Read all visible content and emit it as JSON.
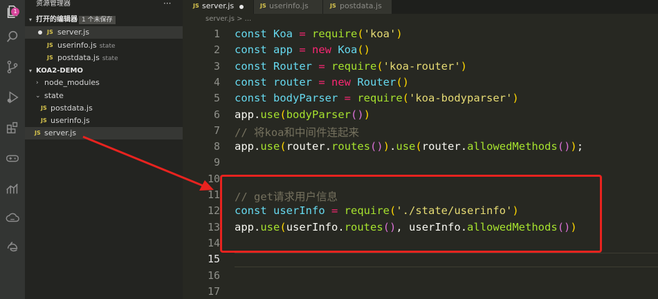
{
  "activity_bar": {
    "badge": "1",
    "icons": [
      "files-icon",
      "search-icon",
      "source-control-icon",
      "run-debug-icon",
      "extensions-icon",
      "gamepad-icon",
      "chart-icon",
      "cloud-icon",
      "edge-icon"
    ]
  },
  "sidebar": {
    "title": "资源管理器",
    "more": "···",
    "open_editors": {
      "label": "打开的编辑器",
      "badge": "1 个未保存",
      "items": [
        {
          "icon": "JS",
          "name": "server.js",
          "hint": ""
        },
        {
          "icon": "JS",
          "name": "userinfo.js",
          "hint": "state"
        },
        {
          "icon": "JS",
          "name": "postdata.js",
          "hint": "state"
        }
      ]
    },
    "project": {
      "label": "KOA2-DEMO",
      "items": [
        {
          "name": "node_modules",
          "type": "folder-collapsed"
        },
        {
          "name": "state",
          "type": "folder-expanded"
        },
        {
          "icon": "JS",
          "name": "postdata.js",
          "type": "file"
        },
        {
          "icon": "JS",
          "name": "userinfo.js",
          "type": "file"
        },
        {
          "icon": "JS",
          "name": "server.js",
          "type": "file"
        }
      ]
    }
  },
  "tabs": [
    {
      "icon": "JS",
      "label": "server.js",
      "unsaved": true,
      "active": true
    },
    {
      "icon": "JS",
      "label": "userinfo.js",
      "unsaved": false,
      "active": false
    },
    {
      "icon": "JS",
      "label": "postdata.js",
      "unsaved": false,
      "active": false
    }
  ],
  "breadcrumb": "server.js > ...",
  "line_numbers": [
    "1",
    "2",
    "3",
    "4",
    "5",
    "6",
    "7",
    "8",
    "9",
    "10",
    "11",
    "12",
    "13",
    "14",
    "15",
    "16",
    "17"
  ],
  "current_line": "15",
  "code_lines": [
    [
      {
        "t": "const ",
        "c": "k"
      },
      {
        "t": "Koa",
        "c": "v"
      },
      {
        "t": " = ",
        "c": "o"
      },
      {
        "t": "require",
        "c": "f"
      },
      {
        "t": "(",
        "c": "b1"
      },
      {
        "t": "'koa'",
        "c": "s"
      },
      {
        "t": ")",
        "c": "b1"
      }
    ],
    [
      {
        "t": "const ",
        "c": "k"
      },
      {
        "t": "app",
        "c": "v"
      },
      {
        "t": " = ",
        "c": "o"
      },
      {
        "t": "new ",
        "c": "o"
      },
      {
        "t": "Koa",
        "c": "v"
      },
      {
        "t": "()",
        "c": "b1"
      }
    ],
    [
      {
        "t": "const ",
        "c": "k"
      },
      {
        "t": "Router",
        "c": "v"
      },
      {
        "t": " = ",
        "c": "o"
      },
      {
        "t": "require",
        "c": "f"
      },
      {
        "t": "(",
        "c": "b1"
      },
      {
        "t": "'koa-router'",
        "c": "s"
      },
      {
        "t": ")",
        "c": "b1"
      }
    ],
    [
      {
        "t": "const ",
        "c": "k"
      },
      {
        "t": "router",
        "c": "v"
      },
      {
        "t": " = ",
        "c": "o"
      },
      {
        "t": "new ",
        "c": "o"
      },
      {
        "t": "Router",
        "c": "v"
      },
      {
        "t": "()",
        "c": "b1"
      }
    ],
    [
      {
        "t": "const ",
        "c": "k"
      },
      {
        "t": "bodyParser",
        "c": "v"
      },
      {
        "t": " = ",
        "c": "o"
      },
      {
        "t": "require",
        "c": "f"
      },
      {
        "t": "(",
        "c": "b1"
      },
      {
        "t": "'koa-bodyparser'",
        "c": "s"
      },
      {
        "t": ")",
        "c": "b1"
      }
    ],
    [
      {
        "t": "app",
        "c": "p"
      },
      {
        "t": ".",
        "c": "p"
      },
      {
        "t": "use",
        "c": "f"
      },
      {
        "t": "(",
        "c": "b1"
      },
      {
        "t": "bodyParser",
        "c": "f"
      },
      {
        "t": "()",
        "c": "b2"
      },
      {
        "t": ")",
        "c": "b1"
      }
    ],
    [
      {
        "t": "// 将koa和中间件连起来",
        "c": "c"
      }
    ],
    [
      {
        "t": "app",
        "c": "p"
      },
      {
        "t": ".",
        "c": "p"
      },
      {
        "t": "use",
        "c": "f"
      },
      {
        "t": "(",
        "c": "b1"
      },
      {
        "t": "router",
        "c": "p"
      },
      {
        "t": ".",
        "c": "p"
      },
      {
        "t": "routes",
        "c": "f"
      },
      {
        "t": "()",
        "c": "b2"
      },
      {
        "t": ")",
        "c": "b1"
      },
      {
        "t": ".",
        "c": "p"
      },
      {
        "t": "use",
        "c": "f"
      },
      {
        "t": "(",
        "c": "b1"
      },
      {
        "t": "router",
        "c": "p"
      },
      {
        "t": ".",
        "c": "p"
      },
      {
        "t": "allowedMethods",
        "c": "f"
      },
      {
        "t": "()",
        "c": "b2"
      },
      {
        "t": ")",
        "c": "b1"
      },
      {
        "t": ";",
        "c": "p"
      }
    ],
    [],
    [],
    [
      {
        "t": "// get请求用户信息",
        "c": "c"
      }
    ],
    [
      {
        "t": "const ",
        "c": "k"
      },
      {
        "t": "userInfo",
        "c": "v"
      },
      {
        "t": " = ",
        "c": "o"
      },
      {
        "t": "require",
        "c": "f"
      },
      {
        "t": "(",
        "c": "b1"
      },
      {
        "t": "'./state/userinfo'",
        "c": "s"
      },
      {
        "t": ")",
        "c": "b1"
      }
    ],
    [
      {
        "t": "app",
        "c": "p"
      },
      {
        "t": ".",
        "c": "p"
      },
      {
        "t": "use",
        "c": "f"
      },
      {
        "t": "(",
        "c": "b1"
      },
      {
        "t": "userInfo",
        "c": "p"
      },
      {
        "t": ".",
        "c": "p"
      },
      {
        "t": "routes",
        "c": "f"
      },
      {
        "t": "()",
        "c": "b2"
      },
      {
        "t": ", ",
        "c": "p"
      },
      {
        "t": "userInfo",
        "c": "p"
      },
      {
        "t": ".",
        "c": "p"
      },
      {
        "t": "allowedMethods",
        "c": "f"
      },
      {
        "t": "()",
        "c": "b2"
      },
      {
        "t": ")",
        "c": "b1"
      }
    ],
    [],
    [],
    [],
    []
  ],
  "annotation_color": "#e8231f"
}
